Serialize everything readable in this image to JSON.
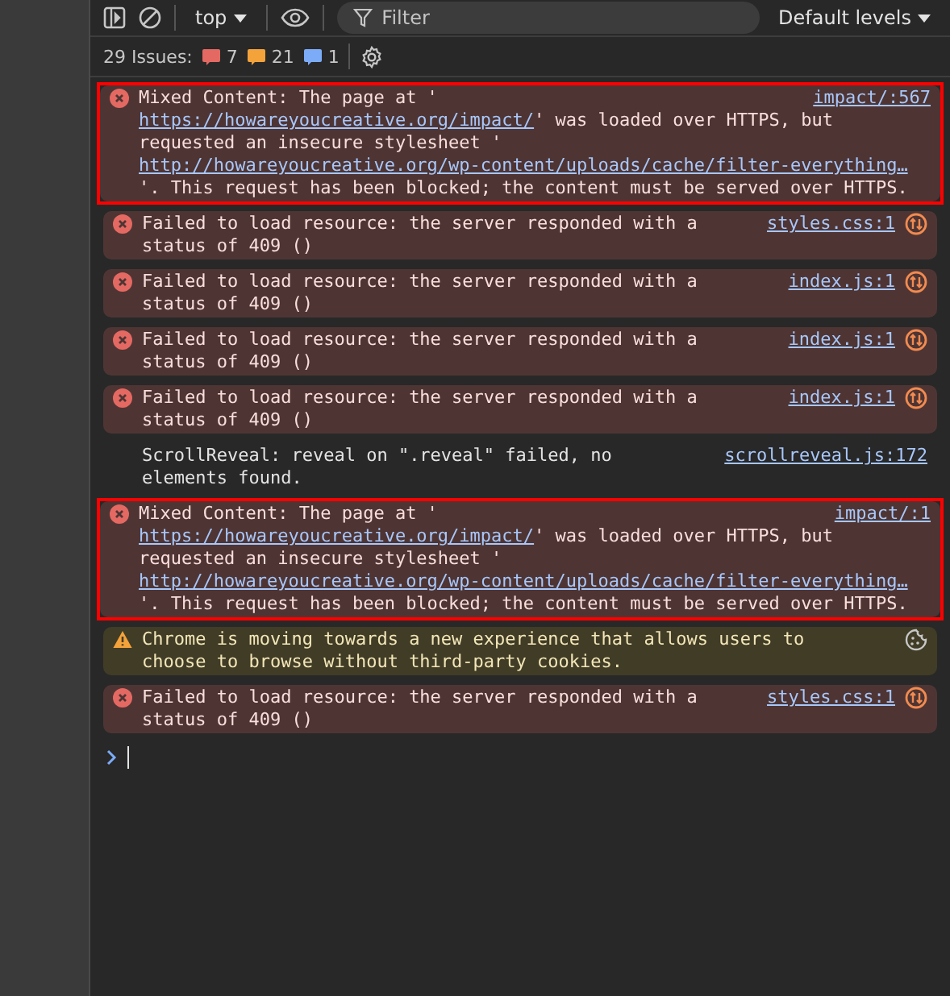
{
  "toolbar": {
    "context": "top",
    "filter": {
      "placeholder": "Filter"
    },
    "levels": "Default levels"
  },
  "issues": {
    "label": "29 Issues:",
    "counts": [
      {
        "kind": "error",
        "count": "7"
      },
      {
        "kind": "warning",
        "count": "21"
      },
      {
        "kind": "info",
        "count": "1"
      }
    ]
  },
  "messages": [
    {
      "kind": "error",
      "highlighted": true,
      "source": "impact/:567",
      "network_request": false,
      "cookie_notice": false,
      "lines": [
        [
          {
            "text": "Mixed Content: The page at '",
            "link": false
          }
        ],
        [
          {
            "text": "https://howareyoucreative.org/impact/",
            "link": true
          },
          {
            "text": "' was loaded over HTTPS, but",
            "link": false
          }
        ],
        [
          {
            "text": "requested an insecure stylesheet '",
            "link": false
          }
        ],
        [
          {
            "text": "http://howareyoucreative.org/wp-content/uploads/cache/filter-everything…",
            "link": true
          }
        ],
        [
          {
            "text": "'. This request has been blocked; the content must be served over HTTPS.",
            "link": false
          }
        ]
      ]
    },
    {
      "kind": "error",
      "highlighted": false,
      "source": "styles.css:1",
      "network_request": true,
      "cookie_notice": false,
      "lines": [
        [
          {
            "text": "Failed to load resource: the server responded with a",
            "link": false
          }
        ],
        [
          {
            "text": "status of 409 ()",
            "link": false
          }
        ]
      ]
    },
    {
      "kind": "error",
      "highlighted": false,
      "source": "index.js:1",
      "network_request": true,
      "cookie_notice": false,
      "lines": [
        [
          {
            "text": "Failed to load resource: the server responded with a",
            "link": false
          }
        ],
        [
          {
            "text": "status of 409 ()",
            "link": false
          }
        ]
      ]
    },
    {
      "kind": "error",
      "highlighted": false,
      "source": "index.js:1",
      "network_request": true,
      "cookie_notice": false,
      "lines": [
        [
          {
            "text": "Failed to load resource: the server responded with a",
            "link": false
          }
        ],
        [
          {
            "text": "status of 409 ()",
            "link": false
          }
        ]
      ]
    },
    {
      "kind": "error",
      "highlighted": false,
      "source": "index.js:1",
      "network_request": true,
      "cookie_notice": false,
      "lines": [
        [
          {
            "text": "Failed to load resource: the server responded with a",
            "link": false
          }
        ],
        [
          {
            "text": "status of 409 ()",
            "link": false
          }
        ]
      ]
    },
    {
      "kind": "log",
      "highlighted": false,
      "source": "scrollreveal.js:172",
      "network_request": false,
      "cookie_notice": false,
      "lines": [
        [
          {
            "text": "ScrollReveal: reveal on \".reveal\" failed, no",
            "link": false
          }
        ],
        [
          {
            "text": "elements found.",
            "link": false
          }
        ]
      ]
    },
    {
      "kind": "error",
      "highlighted": true,
      "source": "impact/:1",
      "network_request": false,
      "cookie_notice": false,
      "lines": [
        [
          {
            "text": "Mixed Content: The page at '",
            "link": false
          }
        ],
        [
          {
            "text": "https://howareyoucreative.org/impact/",
            "link": true
          },
          {
            "text": "' was loaded over HTTPS, but",
            "link": false
          }
        ],
        [
          {
            "text": "requested an insecure stylesheet '",
            "link": false
          }
        ],
        [
          {
            "text": "http://howareyoucreative.org/wp-content/uploads/cache/filter-everything…",
            "link": true
          }
        ],
        [
          {
            "text": "'. This request has been blocked; the content must be served over HTTPS.",
            "link": false
          }
        ]
      ]
    },
    {
      "kind": "warning",
      "highlighted": false,
      "network_request": false,
      "cookie_notice": true,
      "lines": [
        [
          {
            "text": "Chrome is moving towards a new experience that allows users to",
            "link": false
          }
        ],
        [
          {
            "text": "choose to browse without third-party cookies.",
            "link": false
          }
        ]
      ]
    },
    {
      "kind": "error",
      "highlighted": false,
      "source": "styles.css:1",
      "network_request": true,
      "cookie_notice": false,
      "lines": [
        [
          {
            "text": "Failed to load resource: the server responded with a",
            "link": false
          }
        ],
        [
          {
            "text": "status of 409 ()",
            "link": false
          }
        ]
      ]
    }
  ]
}
